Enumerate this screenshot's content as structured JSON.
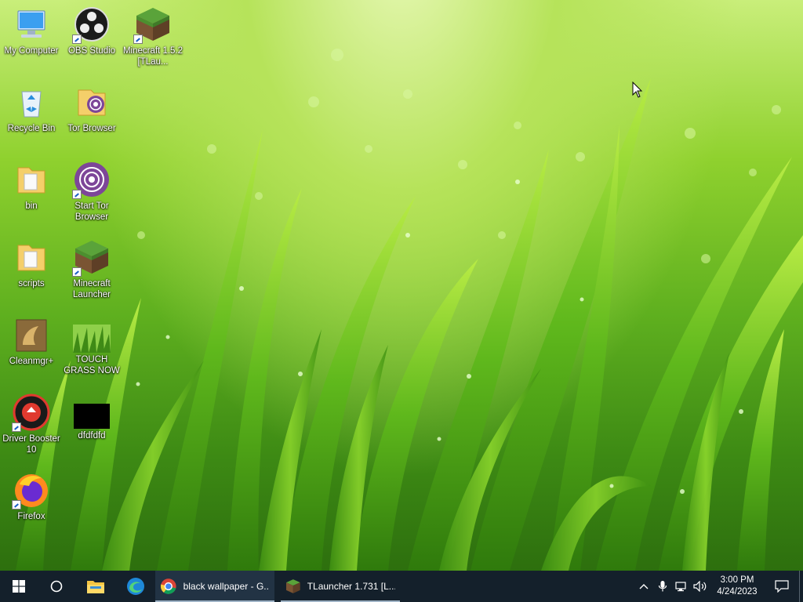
{
  "desktop": {
    "icons": [
      {
        "label": "My Computer"
      },
      {
        "label": "OBS Studio"
      },
      {
        "label": "Minecraft 1.5.2 [TLau..."
      },
      {
        "label": "Recycle Bin"
      },
      {
        "label": "Tor Browser"
      },
      {
        "label": "bin"
      },
      {
        "label": "Start Tor Browser"
      },
      {
        "label": "scripts"
      },
      {
        "label": "Minecraft Launcher"
      },
      {
        "label": "Cleanmgr+"
      },
      {
        "label": "TOUCH GRASS NOW"
      },
      {
        "label": "Driver Booster 10"
      },
      {
        "label": "dfdfdfd"
      },
      {
        "label": "Firefox"
      }
    ]
  },
  "taskbar": {
    "apps": [
      {
        "label": "black wallpaper - G...",
        "icon": "chrome-icon"
      },
      {
        "label": "TLauncher 1.731 [L...",
        "icon": "minecraft-icon"
      }
    ],
    "clock": {
      "time": "3:00 PM",
      "date": "4/24/2023"
    }
  },
  "colors": {
    "taskbar": "#14202b",
    "grass": "#5fb01f"
  }
}
